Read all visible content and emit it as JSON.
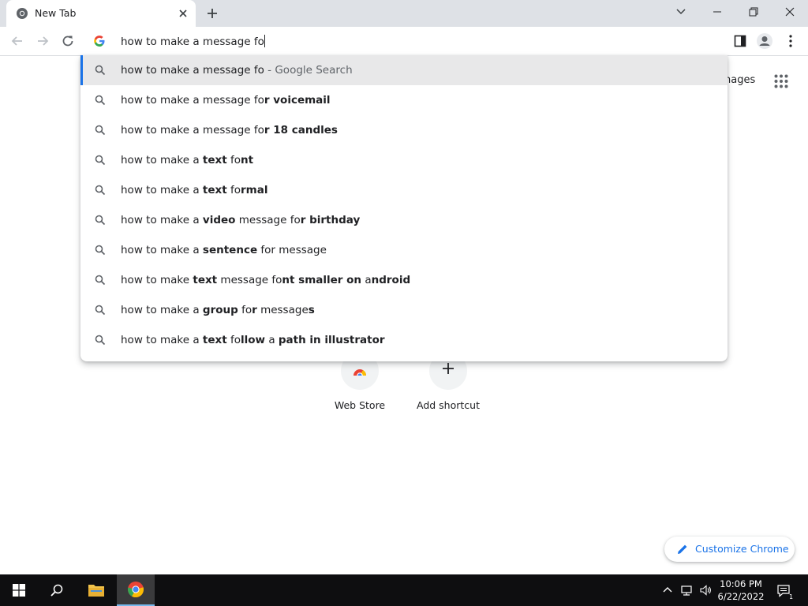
{
  "window": {
    "tab_title": "New Tab"
  },
  "omnibox": {
    "value": "how to make a message fo"
  },
  "suggestions": [
    {
      "segments": [
        {
          "t": "how to make a message fo",
          "b": false
        }
      ],
      "suffix": " - Google Search",
      "selected": true
    },
    {
      "segments": [
        {
          "t": "how to make a message fo",
          "b": false
        },
        {
          "t": "r voicemail",
          "b": true
        }
      ],
      "suffix": "",
      "selected": false
    },
    {
      "segments": [
        {
          "t": "how to make a message fo",
          "b": false
        },
        {
          "t": "r 18 candles",
          "b": true
        }
      ],
      "suffix": "",
      "selected": false
    },
    {
      "segments": [
        {
          "t": "how to make a ",
          "b": false
        },
        {
          "t": "text",
          "b": true
        },
        {
          "t": " fo",
          "b": false
        },
        {
          "t": "nt",
          "b": true
        }
      ],
      "suffix": "",
      "selected": false
    },
    {
      "segments": [
        {
          "t": "how to make a ",
          "b": false
        },
        {
          "t": "text",
          "b": true
        },
        {
          "t": " fo",
          "b": false
        },
        {
          "t": "rmal",
          "b": true
        }
      ],
      "suffix": "",
      "selected": false
    },
    {
      "segments": [
        {
          "t": "how to make a ",
          "b": false
        },
        {
          "t": "video",
          "b": true
        },
        {
          "t": " message fo",
          "b": false
        },
        {
          "t": "r birthday",
          "b": true
        }
      ],
      "suffix": "",
      "selected": false
    },
    {
      "segments": [
        {
          "t": "how to make a ",
          "b": false
        },
        {
          "t": "sentence",
          "b": true
        },
        {
          "t": " fo",
          "b": false
        },
        {
          "t": "r message",
          "b": false
        }
      ],
      "suffix": "",
      "selected": false
    },
    {
      "segments": [
        {
          "t": "how to make ",
          "b": false
        },
        {
          "t": "text",
          "b": true
        },
        {
          "t": " message fo",
          "b": false
        },
        {
          "t": "nt smaller on",
          "b": true
        },
        {
          "t": " a",
          "b": false
        },
        {
          "t": "ndroid",
          "b": true
        }
      ],
      "suffix": "",
      "selected": false
    },
    {
      "segments": [
        {
          "t": "how to make a ",
          "b": false
        },
        {
          "t": "group",
          "b": true
        },
        {
          "t": " fo",
          "b": false
        },
        {
          "t": "r",
          "b": true
        },
        {
          "t": " message",
          "b": false
        },
        {
          "t": "s",
          "b": true
        }
      ],
      "suffix": "",
      "selected": false
    },
    {
      "segments": [
        {
          "t": "how to make a ",
          "b": false
        },
        {
          "t": "text",
          "b": true
        },
        {
          "t": " fo",
          "b": false
        },
        {
          "t": "llow",
          "b": true
        },
        {
          "t": " a ",
          "b": false
        },
        {
          "t": "path in illustrator",
          "b": true
        }
      ],
      "suffix": "",
      "selected": false
    }
  ],
  "page": {
    "images_link": "nages",
    "shortcuts": [
      {
        "label": "Web Store",
        "icon": "chrome-web-store-icon"
      },
      {
        "label": "Add shortcut",
        "icon": "plus-icon"
      }
    ],
    "customize_label": "Customize Chrome"
  },
  "taskbar": {
    "time": "10:06 PM",
    "date": "6/22/2022"
  },
  "colors": {
    "accent": "#1a73e8",
    "tabstrip": "#dee1e6",
    "taskbar": "#0e0e10",
    "selected_row": "#e8e8e9"
  }
}
